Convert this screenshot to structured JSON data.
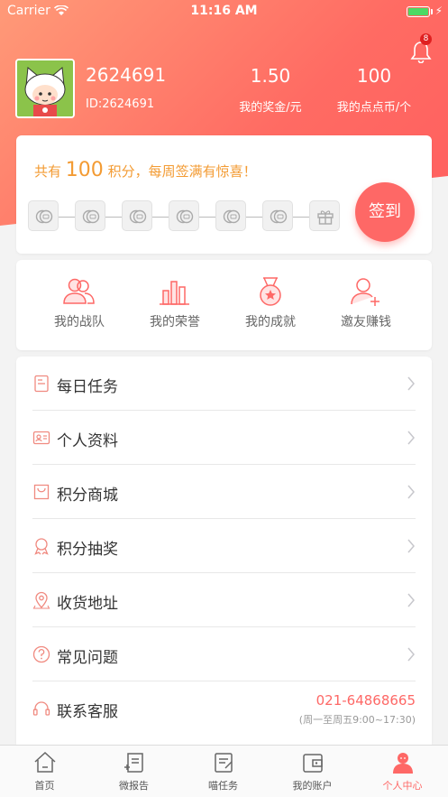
{
  "status_bar": {
    "carrier": "Carrier",
    "time": "11:16 AM"
  },
  "notifications": {
    "badge": "8"
  },
  "user": {
    "name": "2624691",
    "id_label": "ID:2624691"
  },
  "stats": [
    {
      "value": "1.50",
      "label": "我的奖金/元"
    },
    {
      "value": "100",
      "label": "我的点点币/个"
    }
  ],
  "signin": {
    "prefix": "共有",
    "points": "100",
    "suffix": "积分，每周签满有惊喜！",
    "button": "签到",
    "days_total": 7
  },
  "quick": [
    {
      "label": "我的战队",
      "icon": "team-icon"
    },
    {
      "label": "我的荣誉",
      "icon": "honor-icon"
    },
    {
      "label": "我的成就",
      "icon": "medal-icon"
    },
    {
      "label": "邀友赚钱",
      "icon": "invite-icon"
    }
  ],
  "menu": [
    {
      "label": "每日任务",
      "icon": "task-icon"
    },
    {
      "label": "个人资料",
      "icon": "profile-card-icon"
    },
    {
      "label": "积分商城",
      "icon": "shopping-bag-icon"
    },
    {
      "label": "积分抽奖",
      "icon": "award-icon"
    },
    {
      "label": "收货地址",
      "icon": "location-pin-icon"
    },
    {
      "label": "常见问题",
      "icon": "question-icon"
    },
    {
      "label": "联系客服",
      "icon": "headset-icon"
    }
  ],
  "contact": {
    "phone": "021-64868665",
    "hours": "(周一至周五9:00~17:30)"
  },
  "tabs": [
    {
      "label": "首页",
      "icon": "home-icon"
    },
    {
      "label": "微报告",
      "icon": "report-icon"
    },
    {
      "label": "喵任务",
      "icon": "mission-icon"
    },
    {
      "label": "我的账户",
      "icon": "wallet-icon"
    },
    {
      "label": "个人中心",
      "icon": "person-icon",
      "active": true
    }
  ],
  "colors": {
    "accent": "#fe6866",
    "gold": "#f39b33",
    "header_start": "#ff9a78",
    "header_end": "#ff5f5f"
  }
}
